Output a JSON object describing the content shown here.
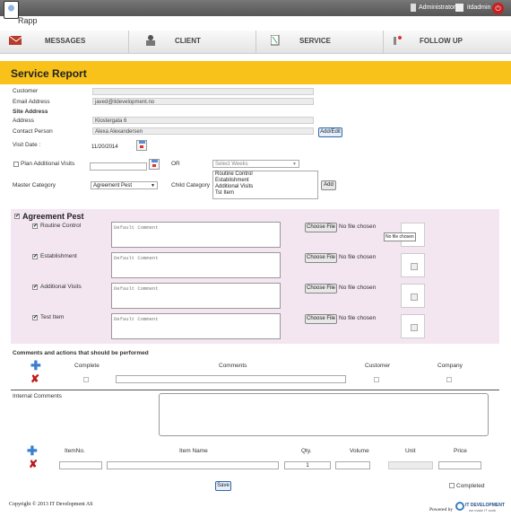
{
  "app": {
    "name": "Rapp"
  },
  "topbar": {
    "role": "Administrator",
    "username": "itdadmin"
  },
  "nav": {
    "messages": "MESSAGES",
    "client": "CLIENT",
    "service": "SERVICE",
    "followup": "FOLLOW UP"
  },
  "page": {
    "title": "Service Report"
  },
  "form": {
    "customer_label": "Customer",
    "customer_value": "",
    "email_label": "Email Address",
    "email_value": "javed@itdevelopment.no",
    "site_address_heading": "Site Address",
    "address_label": "Address",
    "address_value": "Klostergata 6",
    "contact_label": "Contact Person",
    "contact_value": "Alexa Alexandersen",
    "add_edit": "Add/Edit",
    "visit_date_label": "Visit Date :",
    "visit_date_value": "11/20/2014",
    "plan_label": "Plan Additional Visits",
    "or_label": "OR",
    "select_weeks": "Select Weeks",
    "master_label": "Master Category",
    "master_value": "Agreement Pest",
    "child_label": "Child Category",
    "child_options": [
      "Routine Control",
      "Establishment",
      "Additional Visits",
      "Tst Item"
    ],
    "add_label": "Add"
  },
  "agreement": {
    "title": "Agreement Pest",
    "items": [
      {
        "label": "Routine Control",
        "placeholder": "Default Comment",
        "file_button": "Choose File",
        "file_status": "No file chosen"
      },
      {
        "label": "Establishment",
        "placeholder": "Default Comment",
        "file_button": "Choose File",
        "file_status": "No file chosen"
      },
      {
        "label": "Additional Visits",
        "placeholder": "Default Comment",
        "file_button": "Choose File",
        "file_status": "No file chosen"
      },
      {
        "label": "Test Item",
        "placeholder": "Default Comment",
        "file_button": "Choose File",
        "file_status": "No file chosen"
      }
    ],
    "tooltip": "No file chosen"
  },
  "actions": {
    "heading": "Comments and actions that should be performed",
    "col_complete": "Complete",
    "col_comments": "Comments",
    "col_customer": "Customer",
    "col_company": "Company"
  },
  "internal": {
    "label": "Internal Comments"
  },
  "items_table": {
    "col_itemno": "ItemNo.",
    "col_itemname": "Item Name",
    "col_qty": "Qty.",
    "col_volume": "Volume",
    "col_unit": "Unit",
    "col_price": "Price",
    "qty_value": "1"
  },
  "bottom": {
    "save": "Save",
    "completed": "Completed"
  },
  "footer": {
    "copyright": "Copyright © 2013 IT Development AS",
    "powered_by": "Powered by",
    "brand": "IT DEVELOPMENT",
    "brand_tag": "we make IT work"
  },
  "colors": {
    "header": "#f9c21a",
    "panel": "#f3e6f0",
    "topbar": "#666666"
  }
}
